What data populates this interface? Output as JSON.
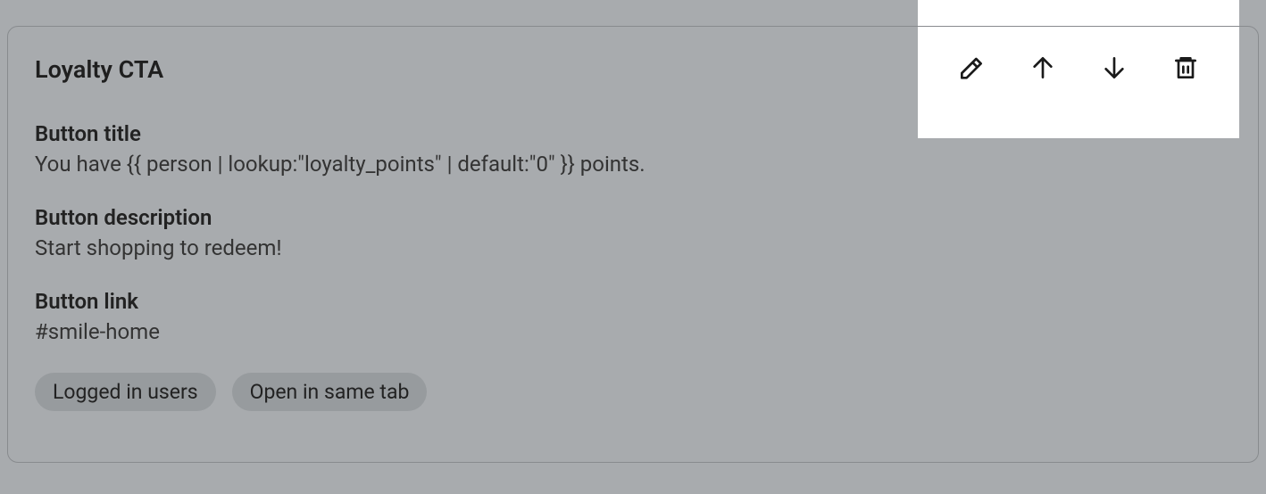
{
  "card": {
    "title": "Loyalty CTA",
    "fields": {
      "button_title": {
        "label": "Button title",
        "value": "You have {{ person | lookup:\"loyalty_points\" | default:\"0\" }} points."
      },
      "button_description": {
        "label": "Button description",
        "value": "Start shopping to redeem!"
      },
      "button_link": {
        "label": "Button link",
        "value": "#smile-home"
      }
    },
    "chips": [
      "Logged in users",
      "Open in same tab"
    ]
  },
  "toolbar": {
    "icons": {
      "edit": "pencil-icon",
      "move_up": "arrow-up-icon",
      "move_down": "arrow-down-icon",
      "delete": "trash-icon"
    }
  }
}
